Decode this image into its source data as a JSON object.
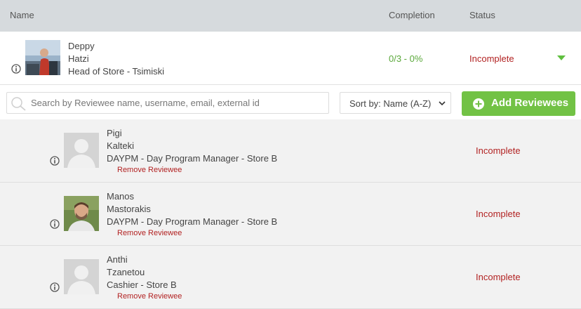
{
  "header": {
    "name": "Name",
    "completion": "Completion",
    "status": "Status"
  },
  "reviewer": {
    "first_name": "Deppy",
    "last_name": "Hatzi",
    "role": "Head of Store - Tsimiski",
    "completion": "0/3 - 0%",
    "status": "Incomplete"
  },
  "search": {
    "placeholder": "Search by Reviewee name, username, email, external id",
    "value": ""
  },
  "sort": {
    "selected": "Sort by: Name (A-Z)"
  },
  "add_button": {
    "label": "Add Reviewees"
  },
  "reviewees": [
    {
      "first_name": "Pigi",
      "last_name": "Kalteki",
      "role": "DAYPM - Day Program Manager - Store B",
      "remove": "Remove Reviewee",
      "status": "Incomplete"
    },
    {
      "first_name": "Manos",
      "last_name": "Mastorakis",
      "role": "DAYPM - Day Program Manager - Store B",
      "remove": "Remove Reviewee",
      "status": "Incomplete"
    },
    {
      "first_name": "Anthi",
      "last_name": "Tzanetou",
      "role": "Cashier - Store B",
      "remove": "Remove Reviewee",
      "status": "Incomplete"
    }
  ],
  "colors": {
    "header_bg": "#d6dadd",
    "accent_green": "#72c245",
    "status_red": "#b22222",
    "completion_green": "#5aa83a"
  }
}
